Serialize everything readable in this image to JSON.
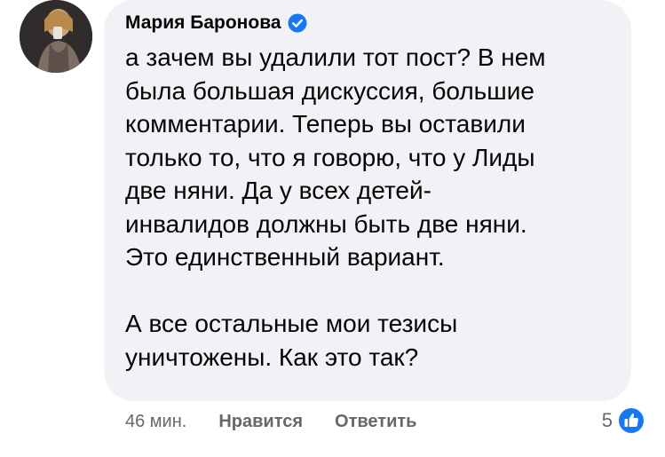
{
  "comment": {
    "author": "Мария Баронова",
    "verified_icon": "verified-badge-icon",
    "text": "а зачем вы удалили тот пост? В нем\nбыла большая дискуссия, большие\nкомментарии. Теперь вы оставили\nтолько то, что я говорю, что у Лиды\nдве няни. Да у всех детей-\nинвалидов должны быть две няни.\nЭто единственный вариант.\n\nА все остальные мои тезисы\nуничтожены. Как это так?",
    "time": "46 мин.",
    "like_label": "Нравится",
    "reply_label": "Ответить",
    "reaction_count": "5",
    "reaction_icon": "like-icon"
  },
  "colors": {
    "bubble": "#f0f2f5",
    "text": "#050505",
    "secondary": "#65676b",
    "accent": "#1877f2"
  }
}
